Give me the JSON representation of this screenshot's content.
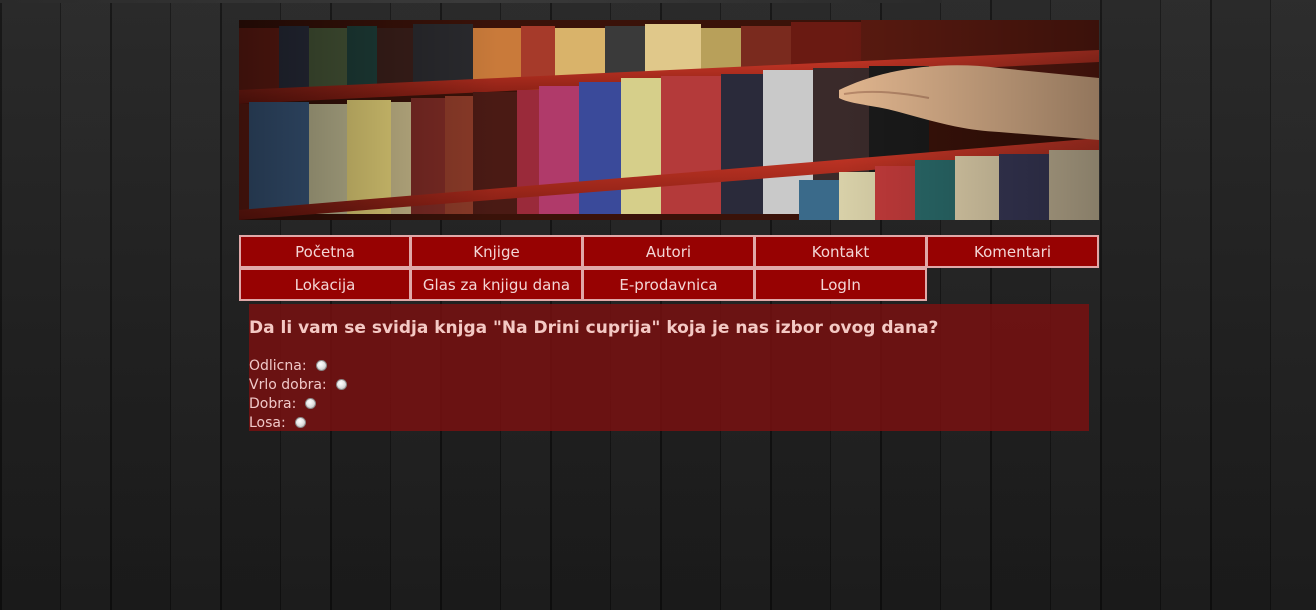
{
  "nav": {
    "row1": [
      "Početna",
      "Knjige",
      "Autori",
      "Kontakt",
      "Komentari"
    ],
    "row2": [
      "Lokacija",
      "Glas za knjigu dana",
      "E-prodavnica",
      "LogIn"
    ]
  },
  "poll": {
    "question": "Da li vam se svidja knjga \"Na Drini cuprija\" koja je nas izbor ovog dana?",
    "options": [
      "Odlicna:",
      "Vrlo dobra:",
      "Dobra:",
      "Losa:"
    ]
  }
}
